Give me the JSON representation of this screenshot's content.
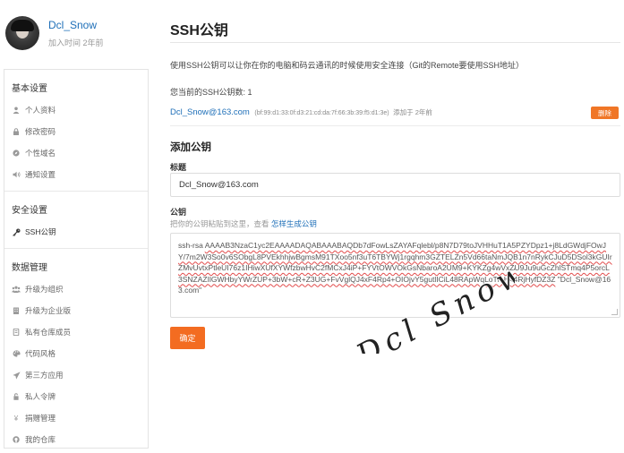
{
  "profile": {
    "name": "Dcl_Snow",
    "joined": "加入时间 2年前"
  },
  "sidebar": {
    "sections": [
      {
        "heading": "基本设置",
        "items": [
          {
            "label": "个人资料",
            "icon": "user-icon"
          },
          {
            "label": "修改密码",
            "icon": "lock-icon"
          },
          {
            "label": "个性域名",
            "icon": "compass-icon"
          },
          {
            "label": "通知设置",
            "icon": "volume-icon"
          }
        ]
      },
      {
        "heading": "安全设置",
        "items": [
          {
            "label": "SSH公钥",
            "icon": "key-icon",
            "active": true
          }
        ]
      },
      {
        "heading": "数据管理",
        "items": [
          {
            "label": "升级为组织",
            "icon": "group-icon"
          },
          {
            "label": "升级为企业版",
            "icon": "building-icon"
          },
          {
            "label": "私有仓库成员",
            "icon": "repo-icon"
          },
          {
            "label": "代码风格",
            "icon": "palette-icon"
          },
          {
            "label": "第三方应用",
            "icon": "plane-icon"
          },
          {
            "label": "私人令牌",
            "icon": "token-icon"
          },
          {
            "label": "捐赠管理",
            "icon": "yen-icon"
          },
          {
            "label": "我的仓库",
            "icon": "github-icon"
          }
        ]
      }
    ]
  },
  "main": {
    "title": "SSH公钥",
    "description": "使用SSH公钥可以让你在你的电脑和码云通讯的时候使用安全连接（Git的Remote要使用SSH地址）",
    "count_text": "您当前的SSH公钥数: 1",
    "key": {
      "email": "Dcl_Snow@163.com",
      "fingerprint": "(bf:99:d1:33:0f:d3:21:cd:da:7f:66:3b:39:f5:d1:3e)",
      "added": "添加于 2年前",
      "delete_label": "删除"
    },
    "add_heading": "添加公钥",
    "title_label": "标题",
    "title_value": "Dcl_Snow@163.com",
    "key_label": "公钥",
    "hint_text": "把你的公钥粘贴到这里，查看",
    "hint_link": "怎样生成公钥",
    "key_prefix": "ssh-rsa ",
    "key_body": "AAAAB3NzaC1yc2EAAAADAQABAAABAQDb7dFowLsZAYAFqlebl/p8N7D79toJVHHuT1A5PZYDpz1+j8LdGWdjFOwJY/7m2W3So0v6SObgL8PVEkhhjwBgmsM91TXoo5nf3uT6TBYWj1rgqhm3GZTELZn5Vd66taNmJQB1n7nRykCJuD5DSol3kGUIrZMvUvtxPtleUI76z1IHiwXUfXYWfzbwHvC2fMCxJ4iP+FYVtOWVOkGsNbaroA2UM9+KYKZg4wVxZU9Ju9uGcZhlSTmq4P5orcL3SNZAZIlGWHbyYWrZUP+3bW+cR+Z3UG+FvVglQJ4xF4Rp4+OIOjvY5gutlICiL48RApWqLoTmH44RjHyfDZ3Z",
    "key_suffix": " \"Dcl_Snow@163.com\"",
    "confirm_label": "确定"
  },
  "watermark": {
    "text": "Dcl Snow"
  },
  "colors": {
    "link": "#1e6fb8",
    "accent": "#f36c21",
    "delete": "#f07626"
  }
}
